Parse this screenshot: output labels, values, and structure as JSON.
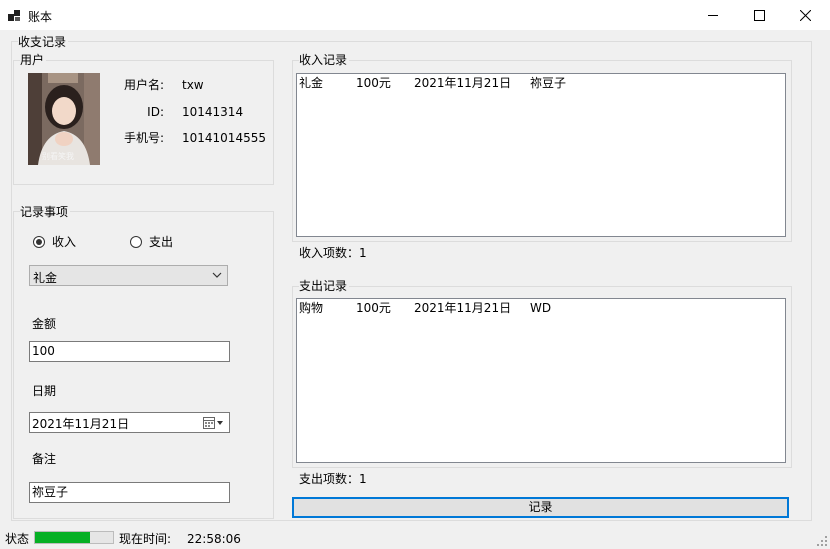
{
  "window": {
    "title": "账本"
  },
  "main_group": {
    "title": "收支记录"
  },
  "user": {
    "title": "用户",
    "username_label": "用户名:",
    "username": "txw",
    "id_label": "ID:",
    "id": "10141314",
    "phone_label": "手机号:",
    "phone": "10141014555",
    "avatar_caption": "别看笑我"
  },
  "entry": {
    "title": "记录事项",
    "income_label": "收入",
    "expense_label": "支出",
    "selected_type": "income",
    "category_value": "礼金",
    "amount_label": "金额",
    "amount_value": "100",
    "date_label": "日期",
    "date_value": "2021年11月21日",
    "note_label": "备注",
    "note_value": "祢豆子"
  },
  "income": {
    "title": "收入记录",
    "rows": [
      {
        "category": "礼金",
        "amount": "100元",
        "date": "2021年11月21日",
        "note": "祢豆子"
      }
    ],
    "count_label": "收入项数：1"
  },
  "expense": {
    "title": "支出记录",
    "rows": [
      {
        "category": "购物",
        "amount": "100元",
        "date": "2021年11月21日",
        "note": "WD"
      }
    ],
    "count_label": "支出项数：1"
  },
  "record_button": {
    "label": "记录"
  },
  "status": {
    "label": "状态",
    "progress": 0.7,
    "time_label": "现在时间:",
    "time_value": "22:58:06"
  },
  "colors": {
    "progress": "#06b025",
    "focus": "#0078d7"
  }
}
